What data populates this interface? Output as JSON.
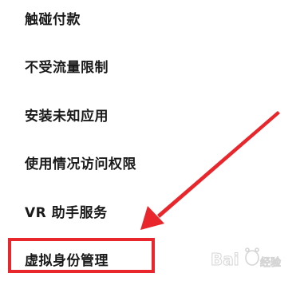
{
  "settings_list": {
    "items": [
      {
        "label": "触碰付款"
      },
      {
        "label": "不受流量限制"
      },
      {
        "label": "安装未知应用"
      },
      {
        "label": "使用情况访问权限"
      },
      {
        "label": "VR 助手服务"
      },
      {
        "label": "虚拟身份管理"
      }
    ]
  },
  "annotation": {
    "color": "#e8262b",
    "highlighted_item": "虚拟身份管理"
  },
  "watermark": {
    "text": "Baidu 经验",
    "brand": "Bai",
    "brand_suffix": "du",
    "subtitle": "经验"
  }
}
